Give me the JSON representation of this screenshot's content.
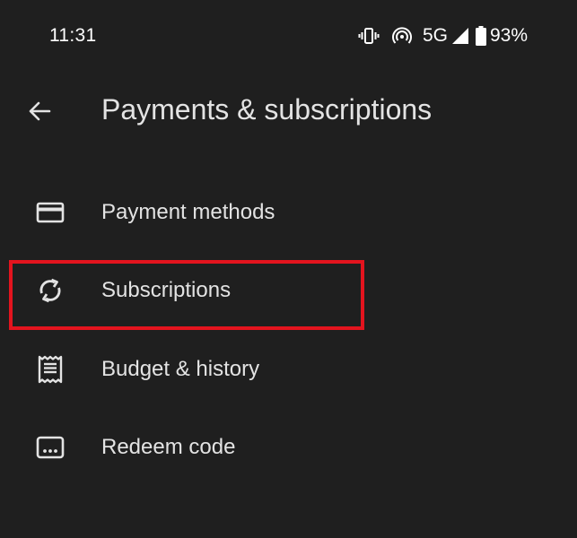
{
  "status_bar": {
    "time": "11:31",
    "network": "5G",
    "battery": "93%",
    "icons": [
      "vibrate-icon",
      "hotspot-icon",
      "signal-icon",
      "battery-icon"
    ]
  },
  "app_bar": {
    "back_icon": "arrow-back-icon",
    "title": "Payments & subscriptions"
  },
  "menu": {
    "items": [
      {
        "icon": "credit-card-icon",
        "label": "Payment methods"
      },
      {
        "icon": "sync-icon",
        "label": "Subscriptions",
        "highlighted": true
      },
      {
        "icon": "receipt-icon",
        "label": "Budget & history"
      },
      {
        "icon": "redeem-code-icon",
        "label": "Redeem code"
      }
    ]
  },
  "colors": {
    "background": "#1f1f1f",
    "text": "#e3e3e3",
    "highlight": "#e3141e"
  }
}
